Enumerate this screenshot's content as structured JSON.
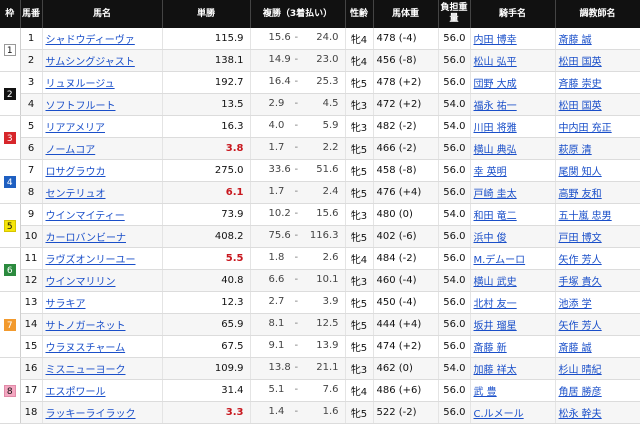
{
  "headers": {
    "waku": "枠",
    "num": "馬番",
    "horse": "馬名",
    "win": "単勝",
    "place": "複勝（3着払い）",
    "sex": "性齢",
    "weight": "馬体重",
    "burden": "負担重量",
    "jockey": "騎手名",
    "trainer": "調教師名"
  },
  "waku_colors": {
    "1": {
      "bg": "#ffffff",
      "fg": "#111111",
      "border": "#999999"
    },
    "2": {
      "bg": "#111111",
      "fg": "#ffffff",
      "border": "#111111"
    },
    "3": {
      "bg": "#d7262b",
      "fg": "#ffffff",
      "border": "#d7262b"
    },
    "4": {
      "bg": "#1e5fc1",
      "fg": "#ffffff",
      "border": "#1e5fc1"
    },
    "5": {
      "bg": "#f5e50a",
      "fg": "#111111",
      "border": "#d6c400"
    },
    "6": {
      "bg": "#2b8a3e",
      "fg": "#ffffff",
      "border": "#2b8a3e"
    },
    "7": {
      "bg": "#f29a2e",
      "fg": "#ffffff",
      "border": "#f29a2e"
    },
    "8": {
      "bg": "#f4a7c1",
      "fg": "#111111",
      "border": "#e08aa8"
    }
  },
  "rows": [
    {
      "waku": "1",
      "num": "1",
      "horse": "シャドウディーヴァ",
      "win": "115.9",
      "top3": false,
      "place_lo": "15.6",
      "place_hi": "24.0",
      "sex": "牝4",
      "weight": "478 (-4)",
      "burden": "56.0",
      "jockey": "内田 博幸",
      "trainer": "斎藤 誠"
    },
    {
      "waku": "1",
      "num": "2",
      "horse": "サムシングジャスト",
      "win": "138.1",
      "top3": false,
      "place_lo": "14.9",
      "place_hi": "23.0",
      "sex": "牝4",
      "weight": "456 (-8)",
      "burden": "56.0",
      "jockey": "松山 弘平",
      "trainer": "松田 国英"
    },
    {
      "waku": "2",
      "num": "3",
      "horse": "リュヌルージュ",
      "win": "192.7",
      "top3": false,
      "place_lo": "16.4",
      "place_hi": "25.3",
      "sex": "牝5",
      "weight": "478 (+2)",
      "burden": "56.0",
      "jockey": "団野 大成",
      "trainer": "斉藤 崇史"
    },
    {
      "waku": "2",
      "num": "4",
      "horse": "ソフトフルート",
      "win": "13.5",
      "top3": false,
      "place_lo": "2.9",
      "place_hi": "4.5",
      "sex": "牝3",
      "weight": "472 (+2)",
      "burden": "54.0",
      "jockey": "福永 祐一",
      "trainer": "松田 国英"
    },
    {
      "waku": "3",
      "num": "5",
      "horse": "リアアメリア",
      "win": "16.3",
      "top3": false,
      "place_lo": "4.0",
      "place_hi": "5.9",
      "sex": "牝3",
      "weight": "482 (-2)",
      "burden": "54.0",
      "jockey": "川田 将雅",
      "trainer": "中内田 充正"
    },
    {
      "waku": "3",
      "num": "6",
      "horse": "ノームコア",
      "win": "3.8",
      "top3": true,
      "place_lo": "1.7",
      "place_hi": "2.2",
      "sex": "牝5",
      "weight": "466 (-2)",
      "burden": "56.0",
      "jockey": "横山 典弘",
      "trainer": "萩原 清"
    },
    {
      "waku": "4",
      "num": "7",
      "horse": "ロサグラウカ",
      "win": "275.0",
      "top3": false,
      "place_lo": "33.6",
      "place_hi": "51.6",
      "sex": "牝5",
      "weight": "458 (-8)",
      "burden": "56.0",
      "jockey": "幸 英明",
      "trainer": "尾関 知人"
    },
    {
      "waku": "4",
      "num": "8",
      "horse": "センテリュオ",
      "win": "6.1",
      "top3": true,
      "place_lo": "1.7",
      "place_hi": "2.4",
      "sex": "牝5",
      "weight": "476 (+4)",
      "burden": "56.0",
      "jockey": "戸崎 圭太",
      "trainer": "高野 友和"
    },
    {
      "waku": "5",
      "num": "9",
      "horse": "ウインマイティー",
      "win": "73.9",
      "top3": false,
      "place_lo": "10.2",
      "place_hi": "15.6",
      "sex": "牝3",
      "weight": "480 (0)",
      "burden": "54.0",
      "jockey": "和田 竜二",
      "trainer": "五十嵐 忠男"
    },
    {
      "waku": "5",
      "num": "10",
      "horse": "カーロバンビーナ",
      "win": "408.2",
      "top3": false,
      "place_lo": "75.6",
      "place_hi": "116.3",
      "sex": "牝5",
      "weight": "402 (-6)",
      "burden": "56.0",
      "jockey": "浜中 俊",
      "trainer": "戸田 博文"
    },
    {
      "waku": "6",
      "num": "11",
      "horse": "ラヴズオンリーユー",
      "win": "5.5",
      "top3": true,
      "place_lo": "1.8",
      "place_hi": "2.6",
      "sex": "牝4",
      "weight": "484 (-2)",
      "burden": "56.0",
      "jockey": "M.デムーロ",
      "trainer": "矢作 芳人"
    },
    {
      "waku": "6",
      "num": "12",
      "horse": "ウインマリリン",
      "win": "40.8",
      "top3": false,
      "place_lo": "6.6",
      "place_hi": "10.1",
      "sex": "牝3",
      "weight": "460 (-4)",
      "burden": "54.0",
      "jockey": "横山 武史",
      "trainer": "手塚 貴久"
    },
    {
      "waku": "7",
      "num": "13",
      "horse": "サラキア",
      "win": "12.3",
      "top3": false,
      "place_lo": "2.7",
      "place_hi": "3.9",
      "sex": "牝5",
      "weight": "450 (-4)",
      "burden": "56.0",
      "jockey": "北村 友一",
      "trainer": "池添 学"
    },
    {
      "waku": "7",
      "num": "14",
      "horse": "サトノガーネット",
      "win": "65.9",
      "top3": false,
      "place_lo": "8.1",
      "place_hi": "12.5",
      "sex": "牝5",
      "weight": "444 (+4)",
      "burden": "56.0",
      "jockey": "坂井 瑠星",
      "trainer": "矢作 芳人"
    },
    {
      "waku": "7",
      "num": "15",
      "horse": "ウラヌスチャーム",
      "win": "67.5",
      "top3": false,
      "place_lo": "9.1",
      "place_hi": "13.9",
      "sex": "牝5",
      "weight": "474 (+2)",
      "burden": "56.0",
      "jockey": "斎藤 新",
      "trainer": "斎藤 誠"
    },
    {
      "waku": "8",
      "num": "16",
      "horse": "ミスニューヨーク",
      "win": "109.9",
      "top3": false,
      "place_lo": "13.8",
      "place_hi": "21.1",
      "sex": "牝3",
      "weight": "462 (0)",
      "burden": "54.0",
      "jockey": "加藤 祥太",
      "trainer": "杉山 晴紀"
    },
    {
      "waku": "8",
      "num": "17",
      "horse": "エスポワール",
      "win": "31.4",
      "top3": false,
      "place_lo": "5.1",
      "place_hi": "7.6",
      "sex": "牝4",
      "weight": "486 (+6)",
      "burden": "56.0",
      "jockey": "武 豊",
      "trainer": "角居 勝彦"
    },
    {
      "waku": "8",
      "num": "18",
      "horse": "ラッキーライラック",
      "win": "3.3",
      "top3": true,
      "place_lo": "1.4",
      "place_hi": "1.6",
      "sex": "牝5",
      "weight": "522 (-2)",
      "burden": "56.0",
      "jockey": "C.ルメール",
      "trainer": "松永 幹夫"
    }
  ]
}
